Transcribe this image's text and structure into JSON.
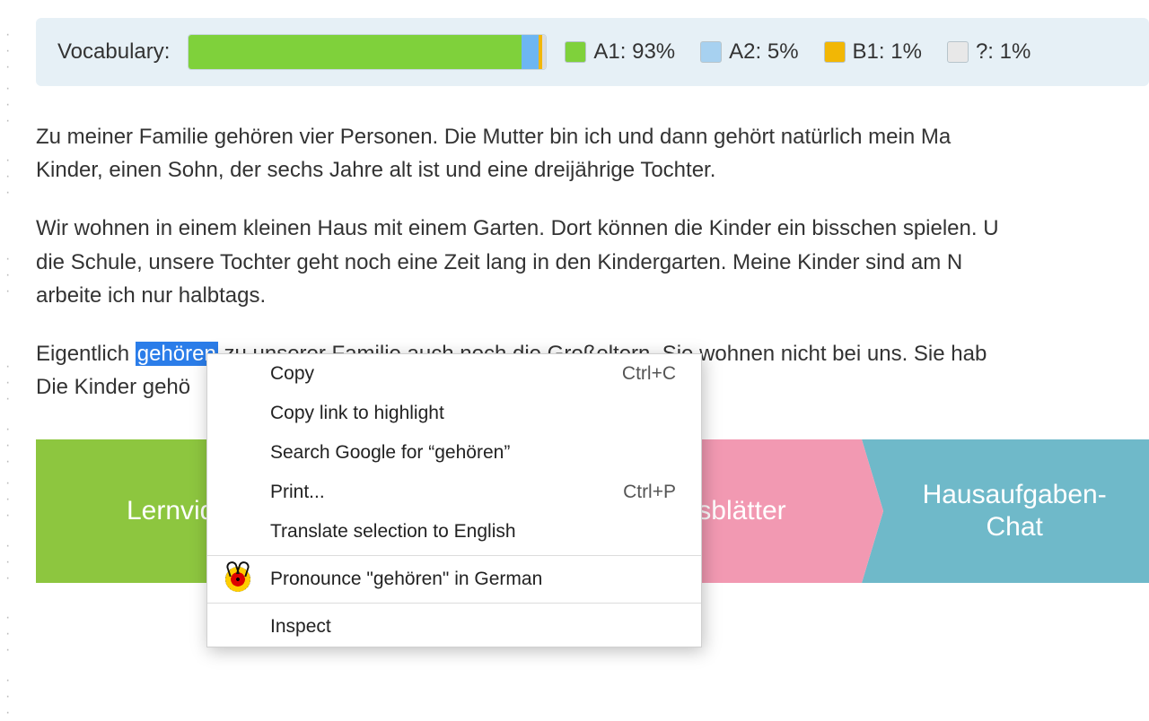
{
  "vocab": {
    "label": "Vocabulary:",
    "levels": {
      "a1": {
        "label": "A1: 93%",
        "pct": 93,
        "color": "#7fd13b"
      },
      "a2": {
        "label": "A2: 5%",
        "pct": 5,
        "color": "#6db6f2"
      },
      "b1": {
        "label": "B1: 1%",
        "pct": 1,
        "color": "#f2b705"
      },
      "unknown": {
        "label": "?: 1%",
        "pct": 1,
        "color": "#dcdcdc"
      }
    }
  },
  "paragraphs": {
    "p1_l1": "Zu meiner Familie gehören vier Personen. Die Mutter bin ich und dann gehört natürlich mein Ma",
    "p1_l2": "Kinder, einen Sohn, der sechs Jahre alt ist und eine dreijährige Tochter.",
    "p2_l1": "Wir wohnen in einem kleinen Haus mit einem Garten. Dort können die Kinder ein bisschen spielen. U",
    "p2_l2": "die Schule, unsere Tochter geht noch eine Zeit lang in den Kindergarten. Meine Kinder sind am N",
    "p2_l3": "arbeite ich nur halbtags.",
    "p3_pre": "Eigentlich ",
    "p3_sel": "gehören",
    "p3_mid": " zu unserer Familie auch noch die Groß",
    "p3_post": "eltern. Sie wohnen nicht bei uns. Sie hab",
    "p3_l2": "Die Kinder gehö"
  },
  "nav": {
    "item1": "Lernvid",
    "item3": "eitsblätter",
    "item4": "Hausaufgaben-\nChat"
  },
  "context_menu": {
    "copy": {
      "label": "Copy",
      "shortcut": "Ctrl+C"
    },
    "copy_link": {
      "label": "Copy link to highlight"
    },
    "search": {
      "label": "Search Google for “gehören”"
    },
    "print": {
      "label": "Print...",
      "shortcut": "Ctrl+P"
    },
    "translate": {
      "label": "Translate selection to English"
    },
    "pronounce": {
      "label": "Pronounce \"gehören\" in German"
    },
    "inspect": {
      "label": "Inspect"
    }
  },
  "chart_data": {
    "type": "bar",
    "title": "Vocabulary",
    "categories": [
      "A1",
      "A2",
      "B1",
      "?"
    ],
    "values": [
      93,
      5,
      1,
      1
    ],
    "xlabel": "",
    "ylabel": "%",
    "ylim": [
      0,
      100
    ]
  }
}
